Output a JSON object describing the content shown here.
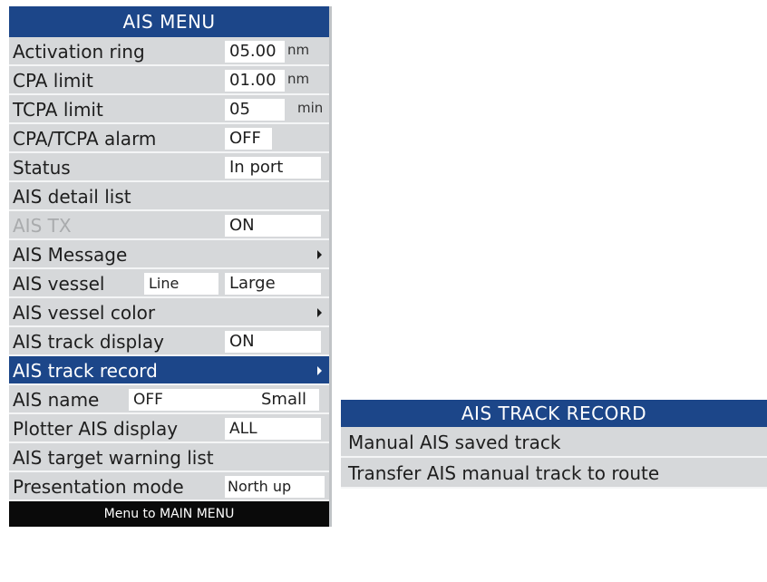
{
  "ais_menu": {
    "title": "AIS MENU",
    "items": [
      {
        "label": "Activation ring",
        "value": "05.00",
        "unit": "nm"
      },
      {
        "label": "CPA limit",
        "value": "01.00",
        "unit": "nm"
      },
      {
        "label": "TCPA limit",
        "value": "05",
        "unit": "min"
      },
      {
        "label": "CPA/TCPA alarm",
        "value": "OFF"
      },
      {
        "label": "Status",
        "value": "In port"
      },
      {
        "label": "AIS detail list"
      },
      {
        "label": "AIS TX",
        "value": "ON"
      },
      {
        "label": "AIS Message"
      },
      {
        "label": "AIS vessel",
        "value": "Line",
        "value2": "Large"
      },
      {
        "label": "AIS vessel color"
      },
      {
        "label": "AIS track display",
        "value": "ON"
      },
      {
        "label": "AIS track record"
      },
      {
        "label": "AIS name",
        "value": "OFF",
        "value2": "Small"
      },
      {
        "label": "Plotter AIS display",
        "value": "ALL"
      },
      {
        "label": "AIS target warning list"
      },
      {
        "label": "Presentation mode",
        "value": "North up"
      }
    ],
    "footer": "Menu to MAIN MENU"
  },
  "ais_track_record": {
    "title": "AIS TRACK RECORD",
    "items": [
      "Manual AIS saved track",
      "Transfer AIS manual track to route"
    ]
  },
  "colors": {
    "title_bar": "#1c4689",
    "menu_background": "#d6d8da",
    "value_box": "#ffffff",
    "footer_background": "#0a0a0a",
    "disabled_text": "#a9abad"
  }
}
